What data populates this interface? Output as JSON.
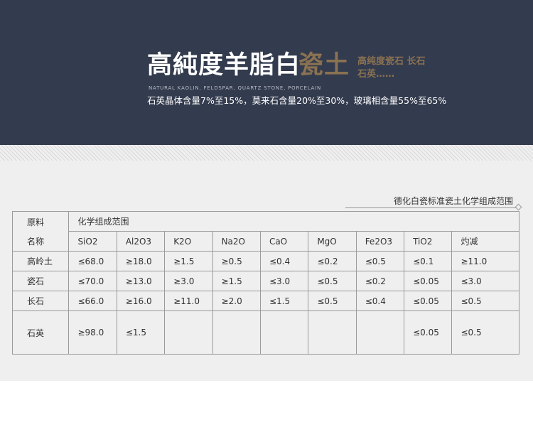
{
  "banner": {
    "title_main": "高純度羊脂白",
    "title_accent": "瓷土",
    "side_line1": "高纯度瓷石 长石",
    "side_line2": "石英……",
    "subtitle_en": "NATURAL KAOLIN, FELDSPAR, QUARTZ STONE, PORCELAIN",
    "subtitle_cn": "石英晶体含量7%至15%，莫来石含量20%至30%，玻璃相含量55%至65%"
  },
  "caption": "德化白瓷标准瓷土化学组成范围",
  "table": {
    "corner_line1": "原料",
    "corner_line2": "名称",
    "group_header": "化学组成范围",
    "columns": [
      "SiO2",
      "Al2O3",
      "K2O",
      "Na2O",
      "CaO",
      "MgO",
      "Fe2O3",
      "TiO2",
      "灼减"
    ],
    "rows": [
      {
        "name": "高岭土",
        "values": [
          "≤68.0",
          "≥18.0",
          "≥1.5",
          "≥0.5",
          "≤0.4",
          "≤0.2",
          "≤0.5",
          "≤0.1",
          "≥11.0"
        ]
      },
      {
        "name": "瓷石",
        "values": [
          "≤70.0",
          "≥13.0",
          "≥3.0",
          "≥1.5",
          "≤3.0",
          "≤0.5",
          "≤0.2",
          "≤0.05",
          "≤3.0"
        ]
      },
      {
        "name": "长石",
        "values": [
          "≤66.0",
          "≥16.0",
          "≥11.0",
          "≥2.0",
          "≤1.5",
          "≤0.5",
          "≤0.4",
          "≤0.05",
          "≤0.5"
        ]
      },
      {
        "name": "石英",
        "values": [
          "≥98.0",
          "≤1.5",
          "",
          "",
          "",
          "",
          "",
          "≤0.05",
          "≤0.5"
        ]
      }
    ]
  }
}
